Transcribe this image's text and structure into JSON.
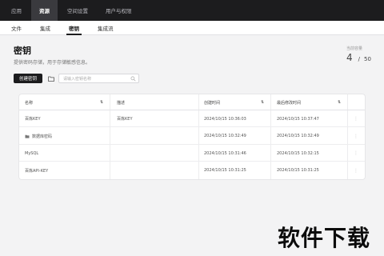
{
  "topnav": {
    "items": [
      {
        "label": "应用",
        "active": false
      },
      {
        "label": "资源",
        "active": true
      },
      {
        "label": "空间设置",
        "active": false
      },
      {
        "label": "用户与权限",
        "active": false
      }
    ]
  },
  "subtabs": [
    {
      "label": "文件",
      "active": false
    },
    {
      "label": "集成",
      "active": false
    },
    {
      "label": "密钥",
      "active": true
    },
    {
      "label": "集成流",
      "active": false
    }
  ],
  "page": {
    "title": "密钥",
    "description": "提供密码存储，用于存储敏感信息。"
  },
  "quota": {
    "label": "当前容量",
    "current": "4",
    "separator": "/",
    "max": "50"
  },
  "toolbar": {
    "create_label": "创建密钥",
    "search_placeholder": "请输入密钥名称"
  },
  "table": {
    "columns": [
      {
        "label": "名称",
        "sortable": true
      },
      {
        "label": "描述",
        "sortable": false
      },
      {
        "label": "创建时间",
        "sortable": true
      },
      {
        "label": "最后修改时间",
        "sortable": true
      }
    ],
    "rows": [
      {
        "name": "百炼KEY",
        "folder": false,
        "desc": "百炼KEY",
        "created": "2024/10/15 10:36:03",
        "modified": "2024/10/15 10:37:47"
      },
      {
        "name": "数据库密码",
        "folder": true,
        "desc": "",
        "created": "2024/10/15 10:32:49",
        "modified": "2024/10/15 10:32:49"
      },
      {
        "name": "MySQL",
        "folder": false,
        "desc": "",
        "created": "2024/10/15 10:31:46",
        "modified": "2024/10/15 10:32:15"
      },
      {
        "name": "百炼API-KEY",
        "folder": false,
        "desc": "",
        "created": "2024/10/15 10:31:25",
        "modified": "2024/10/15 10:31:25"
      }
    ]
  },
  "watermark": "软件下载",
  "colors": {
    "nav_bg": "#1c1c1e",
    "page_bg": "#f3f3f4",
    "primary_button": "#1c1c1e"
  }
}
